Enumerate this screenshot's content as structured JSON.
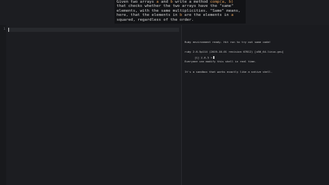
{
  "prompt": {
    "part1": "Given two arrays ",
    "var_a": "a",
    "and_text": " and ",
    "var_b": "b",
    "part2": " write a method ",
    "method_sig": "comp(a, b)",
    "part3": " that checks whether the two arrays have the \"same\" elements, with the same multiplicities. \"Same\" means, here, that the elements in ",
    "var_b2": "b",
    "part4": " are the elements in ",
    "var_a2": "a",
    "part5": " squared, regardless of the order."
  },
  "editor": {
    "line_number": "1"
  },
  "console": {
    "lines": [
      "Ruby environment ready. Hit run to try out some code!",
      "ruby 2.6.5p114 (2019-10-01 revision 67812) [x86_64-linux-gnu]",
      "Everyone can modify this shell in real time.",
      "It's a sandbox that works exactly like a native shell."
    ],
    "prompt": "[1] 2.6.5 >"
  },
  "colors": {
    "background": "#1c1d21",
    "banner_background": "#121316",
    "code_highlight": "#e5a25c",
    "text": "#d4d4d4"
  }
}
